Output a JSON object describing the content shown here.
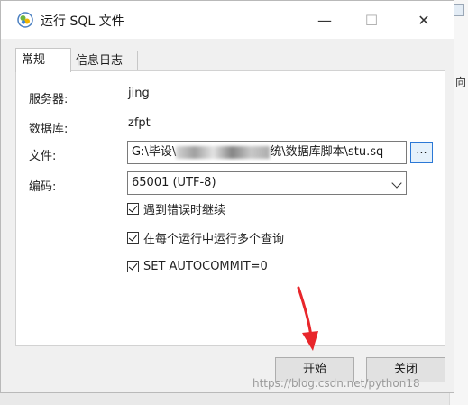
{
  "window": {
    "title": "运行 SQL 文件",
    "minimize_glyph": "—",
    "maximize_glyph": "☐",
    "close_glyph": "✕"
  },
  "tabs": [
    {
      "label": "常规",
      "active": true
    },
    {
      "label": "信息日志",
      "active": false
    }
  ],
  "form": {
    "server_label": "服务器:",
    "server_value": "jing",
    "database_label": "数据库:",
    "database_value": "zfpt",
    "file_label": "文件:",
    "file_value_start": "G:\\毕设\\",
    "file_value_end": "统\\数据库脚本\\stu.sq",
    "browse_label": "...",
    "encoding_label": "编码:",
    "encoding_value": "65001 (UTF-8)"
  },
  "options": [
    {
      "label": "遇到错误时继续",
      "checked": true
    },
    {
      "label": "在每个运行中运行多个查询",
      "checked": true
    },
    {
      "label": "SET AUTOCOMMIT=0",
      "checked": true
    }
  ],
  "buttons": {
    "start": "开始",
    "close": "关闭"
  },
  "background": {
    "right_text": "向"
  },
  "watermark": "https://blog.csdn.net/python18",
  "colors": {
    "accent": "#2b78d6",
    "arrow": "#e8262b"
  }
}
